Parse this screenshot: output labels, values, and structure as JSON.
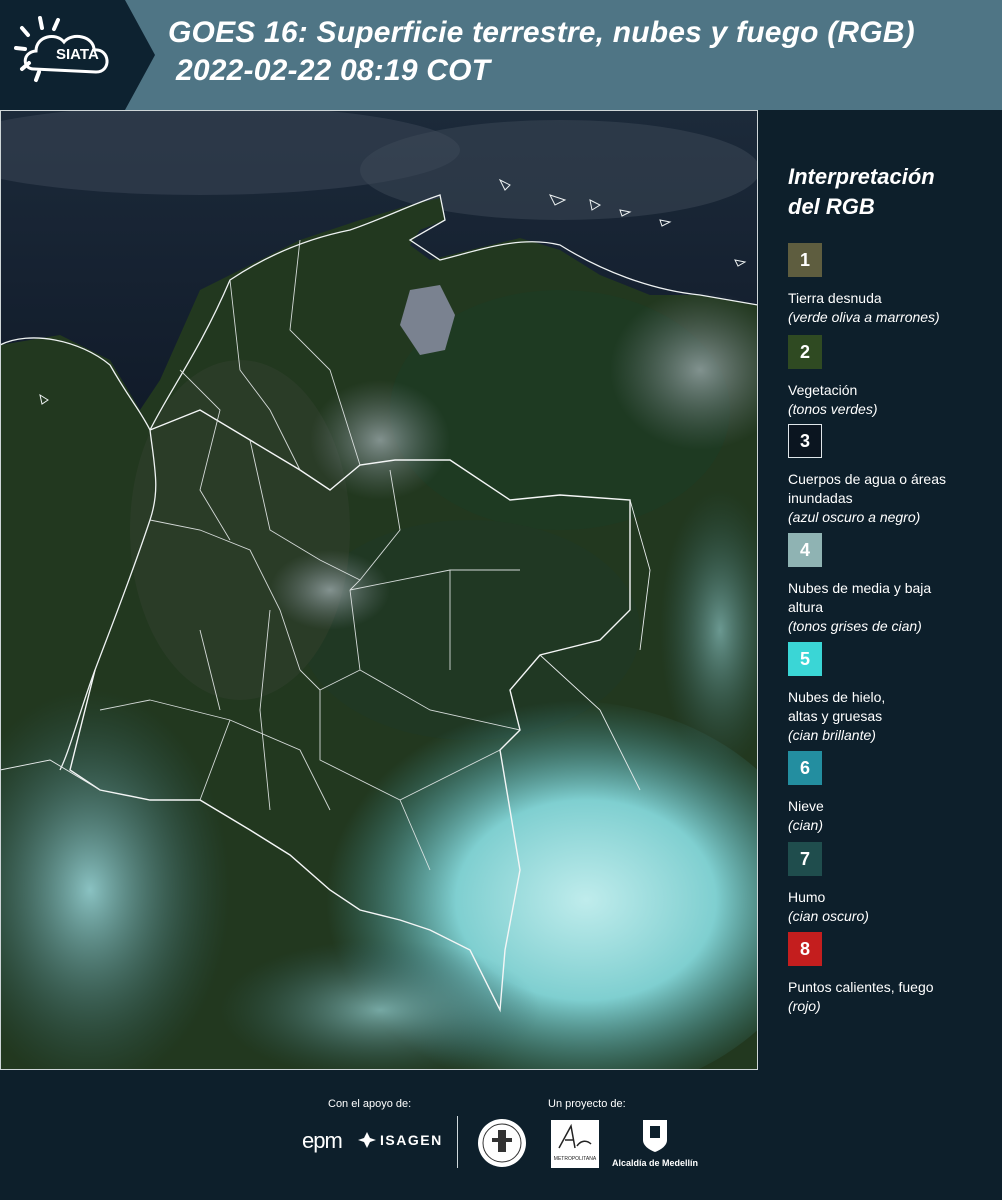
{
  "header": {
    "logo_text": "SIATA",
    "title_line1": "GOES 16: Superficie terrestre, nubes y fuego (RGB)",
    "title_line2": "2022-02-22 08:19 COT"
  },
  "legend": {
    "title_line1": "Interpretación",
    "title_line2": "del RGB",
    "items": [
      {
        "num": "1",
        "color": "#5e5d3f",
        "label": "Tierra desnuda",
        "desc": "(verde oliva a marrones)"
      },
      {
        "num": "2",
        "color": "#2f4a22",
        "label": "Vegetación",
        "desc": "(tonos verdes)"
      },
      {
        "num": "3",
        "color": "#0b1520",
        "label": "Cuerpos de agua o áreas inundadas",
        "desc": "(azul oscuro a negro)"
      },
      {
        "num": "4",
        "color": "#8fb3b3",
        "label": "Nubes de media y baja altura",
        "desc": "(tonos grises de cian)"
      },
      {
        "num": "5",
        "color": "#3ad6d6",
        "label": "Nubes de hielo, altas y gruesas",
        "desc": "(cian brillante)"
      },
      {
        "num": "6",
        "color": "#238ea0",
        "label": "Nieve",
        "desc": "(cian)"
      },
      {
        "num": "7",
        "color": "#1f4d4d",
        "label": "Humo",
        "desc": "(cian oscuro)"
      },
      {
        "num": "8",
        "color": "#c41e1e",
        "label": "Puntos calientes, fuego",
        "desc": "(rojo)"
      }
    ]
  },
  "footer": {
    "support_label": "Con el apoyo de:",
    "project_label": "Un proyecto de:",
    "epm": "epm",
    "isagen": "ISAGEN",
    "area_text": "METROPOLITANA",
    "alcaldia": "Alcaldía de Medellín"
  }
}
